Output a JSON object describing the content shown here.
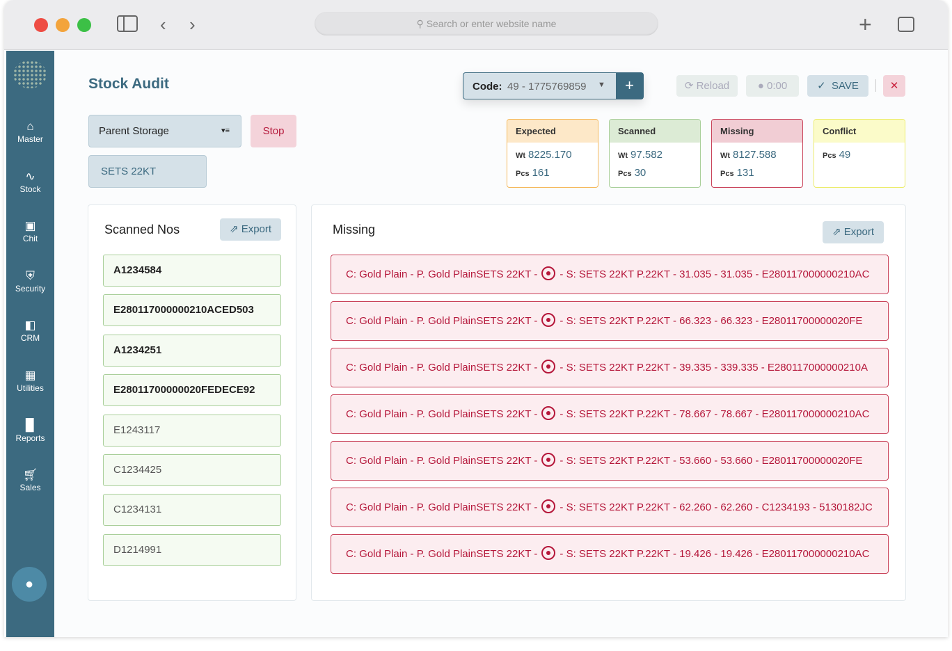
{
  "browser": {
    "search_placeholder": "Search or enter website name"
  },
  "sidebar": {
    "items": [
      {
        "label": "Master",
        "icon": "home-icon"
      },
      {
        "label": "Stock",
        "icon": "pulse-icon"
      },
      {
        "label": "Chit",
        "icon": "chit-icon"
      },
      {
        "label": "Security",
        "icon": "shield-icon"
      },
      {
        "label": "CRM",
        "icon": "crm-icon"
      },
      {
        "label": "Utilities",
        "icon": "calculator-icon"
      },
      {
        "label": "Reports",
        "icon": "bar-chart-icon"
      },
      {
        "label": "Sales",
        "icon": "cart-icon"
      }
    ]
  },
  "page": {
    "title": "Stock Audit"
  },
  "code": {
    "label": "Code:",
    "value": "49 - 1775769859"
  },
  "toolbar": {
    "reload": "Reload",
    "timer": "0:00",
    "save": "SAVE"
  },
  "filters": {
    "parent_storage": "Parent Storage",
    "stop": "Stop",
    "storage_value": "SETS 22KT"
  },
  "summary": {
    "expected": {
      "title": "Expected",
      "wt_label": "Wt",
      "wt": "8225.170",
      "pcs_label": "Pcs",
      "pcs": "161",
      "color": "#f5b85a"
    },
    "scanned": {
      "title": "Scanned",
      "wt_label": "Wt",
      "wt": "97.582",
      "pcs_label": "Pcs",
      "pcs": "30",
      "color": "#a9cf9a"
    },
    "missing": {
      "title": "Missing",
      "wt_label": "Wt",
      "wt": "8127.588",
      "pcs_label": "Pcs",
      "pcs": "131",
      "color": "#c9435a"
    },
    "conflict": {
      "title": "Conflict",
      "pcs_label": "Pcs",
      "pcs": "49",
      "color": "#ecec6a"
    }
  },
  "scanned_panel": {
    "title": "Scanned Nos",
    "export": "Export",
    "items": [
      "A1234584",
      "E280117000000210ACED503",
      "A1234251",
      "E28011700000020FEDECE92",
      "E1243117",
      "C1234425",
      "C1234131",
      "D1214991"
    ]
  },
  "missing_panel": {
    "title": "Missing",
    "export": "Export",
    "items": [
      {
        "prefix": "C: Gold Plain - P. Gold PlainSETS 22KT -",
        "suffix": "- S: SETS 22KT  P.22KT - 31.035 - 31.035 - E280117000000210AC"
      },
      {
        "prefix": "C: Gold Plain - P. Gold PlainSETS 22KT -",
        "suffix": "- S: SETS 22KT  P.22KT - 66.323 - 66.323 - E28011700000020FE"
      },
      {
        "prefix": "C: Gold Plain - P. Gold PlainSETS 22KT -",
        "suffix": "- S: SETS 22KT  P.22KT - 39.335 - 339.335 - E280117000000210A"
      },
      {
        "prefix": "C: Gold Plain - P. Gold PlainSETS 22KT -",
        "suffix": "- S: SETS 22KT  P.22KT - 78.667 - 78.667 - E280117000000210AC"
      },
      {
        "prefix": "C: Gold Plain - P. Gold PlainSETS 22KT -",
        "suffix": "- S: SETS 22KT  P.22KT - 53.660 - 53.660 - E28011700000020FE"
      },
      {
        "prefix": "C: Gold Plain - P. Gold PlainSETS 22KT -",
        "suffix": "- S: SETS 22KT  P.22KT - 62.260 - 62.260 - C1234193 - 5130182JC"
      },
      {
        "prefix": "C: Gold Plain - P. Gold PlainSETS 22KT -",
        "suffix": "- S: SETS 22KT  P.22KT - 19.426 - 19.426 - E280117000000210AC"
      }
    ]
  }
}
